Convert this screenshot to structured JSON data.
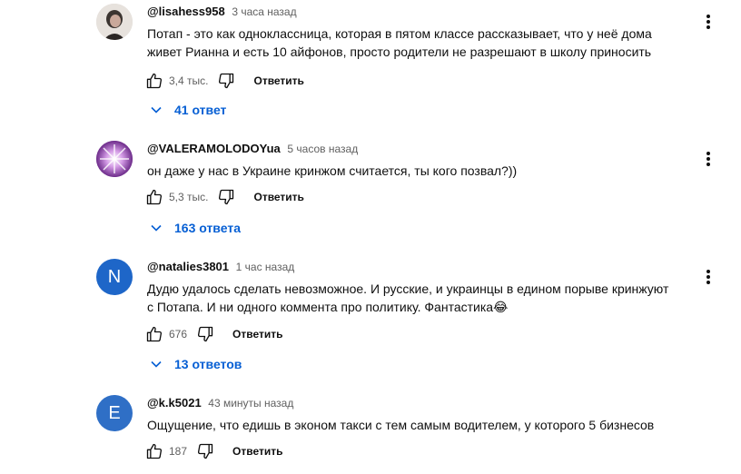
{
  "comments": [
    {
      "author": "@lisahess958",
      "time": "3 часа назад",
      "text": "Потап - это как одноклассница, которая в пятом классе рассказывает, что у неё дома живет Рианна и есть 10 айфонов, просто родители не разрешают в школу приносить",
      "likes": "3,4 тыс.",
      "reply_label": "Ответить",
      "replies_label": "41 ответ",
      "avatar_type": "photo"
    },
    {
      "author": "@VALERAMOLODOYua",
      "time": "5 часов назад",
      "text": "он даже у нас в Украине кринжом считается, ты кого позвал?))",
      "likes": "5,3 тыс.",
      "reply_label": "Ответить",
      "replies_label": "163 ответа",
      "avatar_type": "flower"
    },
    {
      "author": "@natalies3801",
      "time": "1 час назад",
      "text": "Дудю удалось сделать невозможное. И русские, и украинцы в едином порыве кринжуют с Потапа. И ни одного коммента про политику. Фантастика😂",
      "likes": "676",
      "reply_label": "Ответить",
      "replies_label": "13 ответов",
      "avatar_letter": "N",
      "avatar_color": "#1e66c8"
    },
    {
      "author": "@k.k5021",
      "time": "43 минуты назад",
      "text": "Ощущение, что едишь в эконом такси с тем самым водителем, у которого 5 бизнесов",
      "likes": "187",
      "reply_label": "Ответить",
      "avatar_letter": "E",
      "avatar_color": "#2f6fc6"
    }
  ],
  "icons": {
    "like": "thumbs-up-icon",
    "dislike": "thumbs-down-icon",
    "menu": "more-vert-icon",
    "expand": "chevron-down-icon"
  },
  "colors": {
    "link": "#065fd4",
    "secondary_text": "#606060"
  }
}
